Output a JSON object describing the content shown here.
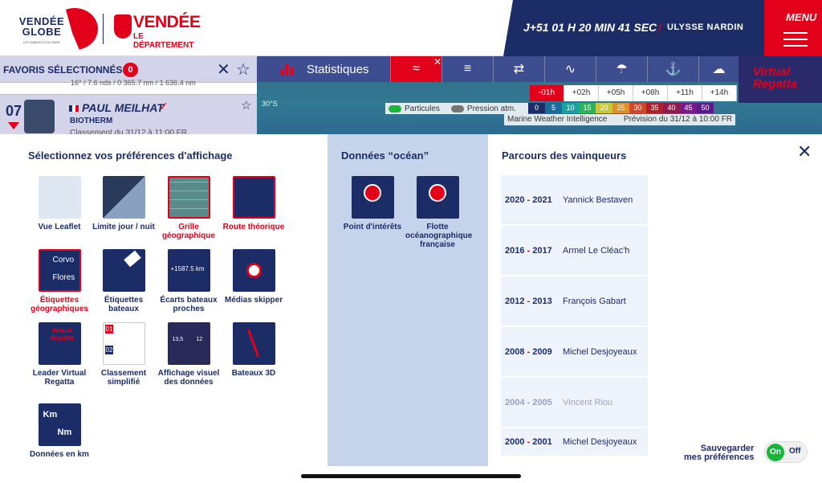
{
  "header": {
    "logo_vendee_globe": "VENDÉE GLOBE",
    "logo_vendee_globe_sub": "LES SABLES D'OLONNE",
    "logo_vendee": "VENDÉE",
    "logo_vendee_sub": "LE DÉPARTEMENT",
    "timer": "J+51  01 H  20 MIN  41 SEC",
    "brand": "ULYSSE NARDIN",
    "menu_label": "MENU"
  },
  "favorites": {
    "title": "FAVORIS SÉLECTIONNÉS",
    "count": "0",
    "fragment": "16° / 7.6 nds / 0 365.7 nm / 1 636.4 nm",
    "skipper": {
      "rank": "07",
      "name": "PAUL MEILHAT",
      "boat": "BIOTHERM",
      "classement": "Classement du 31/12 à 11:00 FR"
    }
  },
  "toolbar": {
    "stats_label": "Statistiques",
    "virtual_regatta": "Virtual Regatta",
    "lat_label": "30°S",
    "timesteps": [
      "-01h",
      "+02h",
      "+05h",
      "+08h",
      "+11h",
      "+14h"
    ],
    "toggle_particules": "Particules",
    "toggle_pression": "Pression atm.",
    "scale": [
      "0",
      "5",
      "10",
      "15",
      "20",
      "25",
      "30",
      "35",
      "40",
      "45",
      "50"
    ],
    "mwi": "Marine Weather Intelligence",
    "prevision": "Prévision du 31/12 à 10:00 FR"
  },
  "prefs": {
    "title": "Sélectionnez vos préférences d'affichage",
    "tiles": [
      {
        "label": "Vue Leaflet"
      },
      {
        "label": "Limite jour / nuit"
      },
      {
        "label": "Grille géographique"
      },
      {
        "label": "Route théorique"
      },
      {
        "label": "Étiquettes géographiques"
      },
      {
        "label": "Étiquettes bateaux"
      },
      {
        "label": "Écarts bateaux proches"
      },
      {
        "label": "Médias skipper"
      },
      {
        "label": "Leader Virtual Regatta"
      },
      {
        "label": "Classement simplifié"
      },
      {
        "label": "Affichage visuel des données"
      },
      {
        "label": "Bateaux 3D"
      },
      {
        "label": "Données en km"
      }
    ],
    "tile_texts": {
      "corvo": "Corvo",
      "flores": "Flores",
      "ecart": "+1587.5 km",
      "rank1": "01",
      "rank2": "02",
      "dial1": "13,5",
      "dial2": "12",
      "km": "Km",
      "nm": "Nm"
    }
  },
  "ocean": {
    "title": "Données “océan”",
    "tiles": [
      {
        "label": "Point d'intérêts"
      },
      {
        "label": "Flotte océanographique française"
      }
    ]
  },
  "winners": {
    "title": "Parcours des vainqueurs",
    "rows": [
      {
        "y1": "2020",
        "y2": "2021",
        "name": "Yannick Bestaven"
      },
      {
        "y1": "2016",
        "y2": "2017",
        "name": "Armel Le Cléac'h"
      },
      {
        "y1": "2012",
        "y2": "2013",
        "name": "François Gabart"
      },
      {
        "y1": "2008",
        "y2": "2009",
        "name": "Michel Desjoyeaux"
      },
      {
        "y1": "2004",
        "y2": "2005",
        "name": "Vincent Riou"
      },
      {
        "y1": "2000",
        "y2": "2001",
        "name": "Michel Desjoyeaux"
      }
    ]
  },
  "save": {
    "line1": "Sauvegarder",
    "line2": "mes préférences",
    "on": "On",
    "off": "Off"
  },
  "colors": {
    "navy": "#1c2c66",
    "red": "#e2001a",
    "green": "#17b53a"
  }
}
